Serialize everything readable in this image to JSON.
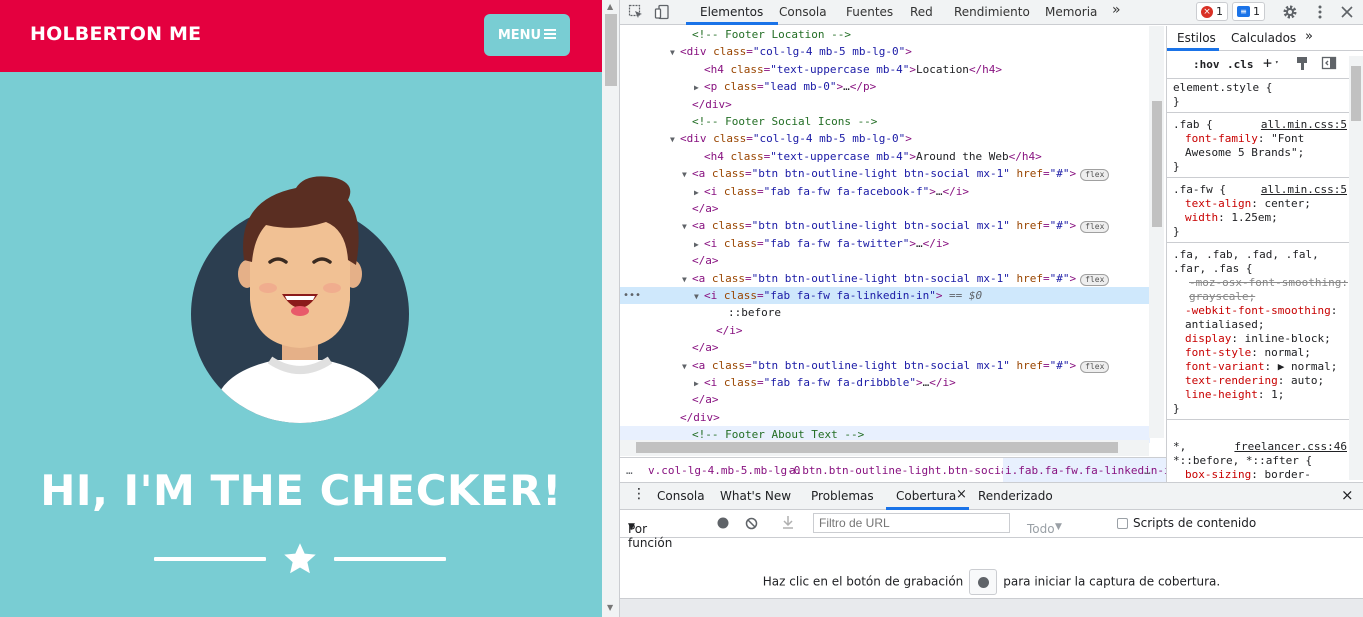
{
  "page": {
    "brand": "HOLBERTON ME",
    "menu_label": "MENU",
    "hero_title": "HI, I'M THE CHECKER!",
    "colors": {
      "navbar": "#e4003f",
      "hero_bg": "#79cdd3"
    }
  },
  "devtools": {
    "tabs": [
      "Elementos",
      "Consola",
      "Fuentes",
      "Red",
      "Rendimiento",
      "Memoria"
    ],
    "more_tabs": "»",
    "error_count": "1",
    "message_count": "1",
    "elements": {
      "lines": [
        {
          "kind": "comment",
          "text": "<!-- Footer Location -->"
        },
        {
          "kind": "tag",
          "open": "<div",
          "attrs": [
            {
              "n": "class",
              "v": "\"col-lg-4 mb-5 mb-lg-0\""
            }
          ],
          "close": ">"
        },
        {
          "kind": "tag",
          "open": "<h4",
          "attrs": [
            {
              "n": "class",
              "v": "\"text-uppercase mb-4\""
            }
          ],
          "close": ">",
          "text": "Location",
          "end": "</h4>"
        },
        {
          "kind": "tag",
          "open": "<p",
          "attrs": [
            {
              "n": "class",
              "v": "\"lead mb-0\""
            }
          ],
          "close": ">",
          "text": "…",
          "end": "</p>"
        },
        {
          "kind": "end",
          "end": "</div>"
        },
        {
          "kind": "comment",
          "text": "<!-- Footer Social Icons -->"
        },
        {
          "kind": "tag",
          "open": "<div",
          "attrs": [
            {
              "n": "class",
              "v": "\"col-lg-4 mb-5 mb-lg-0\""
            }
          ],
          "close": ">"
        },
        {
          "kind": "tag",
          "open": "<h4",
          "attrs": [
            {
              "n": "class",
              "v": "\"text-uppercase mb-4\""
            }
          ],
          "close": ">",
          "text": "Around the Web",
          "end": "</h4>"
        },
        {
          "kind": "tag",
          "open": "<a",
          "attrs": [
            {
              "n": "class",
              "v": "\"btn btn-outline-light btn-social mx-1\""
            },
            {
              "n": "href",
              "v": "\"#\""
            }
          ],
          "close": ">",
          "badge": "flex"
        },
        {
          "kind": "tag",
          "open": "<i",
          "attrs": [
            {
              "n": "class",
              "v": "\"fab fa-fw fa-facebook-f\""
            }
          ],
          "close": ">",
          "text": "…",
          "end": "</i>"
        },
        {
          "kind": "end",
          "end": "</a>"
        },
        {
          "kind": "tag",
          "open": "<a",
          "attrs": [
            {
              "n": "class",
              "v": "\"btn btn-outline-light btn-social mx-1\""
            },
            {
              "n": "href",
              "v": "\"#\""
            }
          ],
          "close": ">",
          "badge": "flex"
        },
        {
          "kind": "tag",
          "open": "<i",
          "attrs": [
            {
              "n": "class",
              "v": "\"fab fa-fw fa-twitter\""
            }
          ],
          "close": ">",
          "text": "…",
          "end": "</i>"
        },
        {
          "kind": "end",
          "end": "</a>"
        },
        {
          "kind": "tag",
          "open": "<a",
          "attrs": [
            {
              "n": "class",
              "v": "\"btn btn-outline-light btn-social mx-1\""
            },
            {
              "n": "href",
              "v": "\"#\""
            }
          ],
          "close": ">",
          "badge": "flex"
        },
        {
          "kind": "tag",
          "open": "<i",
          "attrs": [
            {
              "n": "class",
              "v": "\"fab fa-fw fa-linkedin-in\""
            }
          ],
          "close": ">",
          "suffix": " == $0"
        },
        {
          "kind": "pseudo",
          "text": "::before"
        },
        {
          "kind": "end",
          "end": "</i>"
        },
        {
          "kind": "end",
          "end": "</a>"
        },
        {
          "kind": "tag",
          "open": "<a",
          "attrs": [
            {
              "n": "class",
              "v": "\"btn btn-outline-light btn-social mx-1\""
            },
            {
              "n": "href",
              "v": "\"#\""
            }
          ],
          "close": ">",
          "badge": "flex"
        },
        {
          "kind": "tag",
          "open": "<i",
          "attrs": [
            {
              "n": "class",
              "v": "\"fab fa-fw fa-dribbble\""
            }
          ],
          "close": ">",
          "text": "…",
          "end": "</i>"
        },
        {
          "kind": "end",
          "end": "</a>"
        },
        {
          "kind": "end",
          "end": "</div>"
        },
        {
          "kind": "comment",
          "text": "<!-- Footer About Text -->"
        }
      ],
      "breadcrumbs": [
        "…",
        "v.col-lg-4.mb-5.mb-lg-0",
        "a.btn.btn-outline-light.btn-social.mx-1",
        "i.fab.fa-fw.fa-linkedin-in",
        "…"
      ]
    },
    "styles": {
      "tabs": [
        "Estilos",
        "Calculados",
        "»"
      ],
      "filter_hov": ":hov",
      "filter_cls": ".cls",
      "rules": [
        {
          "selector": "element.style {",
          "source": "",
          "props": [],
          "close": "}"
        },
        {
          "selector": ".fab {",
          "source": "all.min.css:5",
          "props": [
            {
              "n": "font-family",
              "v": "\"Font Awesome 5 Brands\";"
            }
          ],
          "close": "}"
        },
        {
          "selector": ".fa-fw {",
          "source": "all.min.css:5",
          "props": [
            {
              "n": "text-align",
              "v": "center;"
            },
            {
              "n": "width",
              "v": "1.25em;"
            }
          ],
          "close": "}"
        },
        {
          "selector": ".fa, .fab, .fad, .fal, .far, .fas {",
          "source": "all.min.css:5",
          "props": [
            {
              "n": "-moz-osx-font-smoothing",
              "v": "grayscale;",
              "struck": true
            },
            {
              "n": "-webkit-font-smoothing",
              "v": ": antialiased;"
            },
            {
              "n": "display",
              "v": "inline-block;"
            },
            {
              "n": "font-style",
              "v": "normal;"
            },
            {
              "n": "font-variant",
              "v": "▶ normal;"
            },
            {
              "n": "text-rendering",
              "v": "auto;"
            },
            {
              "n": "line-height",
              "v": "1;"
            }
          ],
          "close": "}"
        },
        {
          "selector": "*,",
          "source": "freelancer.css:46",
          "props": [],
          "extra": "*::before, *::after {",
          "tail": {
            "n": "box-sizing",
            "v": "border-"
          }
        }
      ]
    },
    "drawer": {
      "tabs": [
        "Consola",
        "What's New",
        "Problemas",
        "Cobertura",
        "Renderizado"
      ],
      "per_function": "Por función",
      "url_filter_placeholder": "Filtro de URL",
      "all_select": "Todo",
      "content_scripts_label": "Scripts de contenido",
      "message_before": "Haz clic en el botón de grabación",
      "message_after": "para iniciar la captura de cobertura."
    }
  }
}
